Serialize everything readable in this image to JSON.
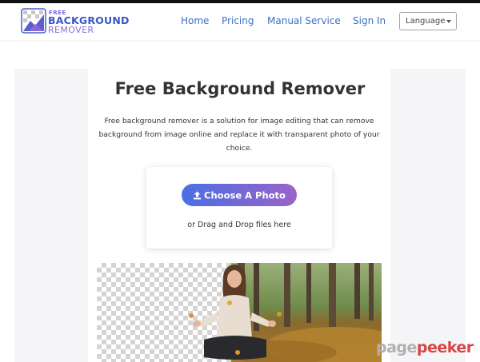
{
  "header": {
    "logo": {
      "line1": "FREE",
      "line2": "BACKGROUND",
      "line3": "REMOVER"
    },
    "nav": [
      {
        "label": "Home"
      },
      {
        "label": "Pricing"
      },
      {
        "label": "Manual Service"
      },
      {
        "label": "Sign In"
      }
    ],
    "language_label": "Language"
  },
  "main": {
    "title": "Free Background Remover",
    "description": "Free background remover is a solution for image editing that can remove background from image online and replace it with transparent photo of your choice.",
    "upload": {
      "button_label": "Choose A Photo",
      "drag_text": "or Drag and Drop files here"
    }
  },
  "watermark": {
    "part1": "page",
    "part2": "peeker"
  },
  "colors": {
    "nav_link": "#3e6fc6",
    "button_start": "#4a6fe3",
    "button_end": "#9a63c9",
    "watermark_red": "#d84545"
  },
  "icons": [
    "logo-icon",
    "upload-icon",
    "chevron-down-icon"
  ]
}
